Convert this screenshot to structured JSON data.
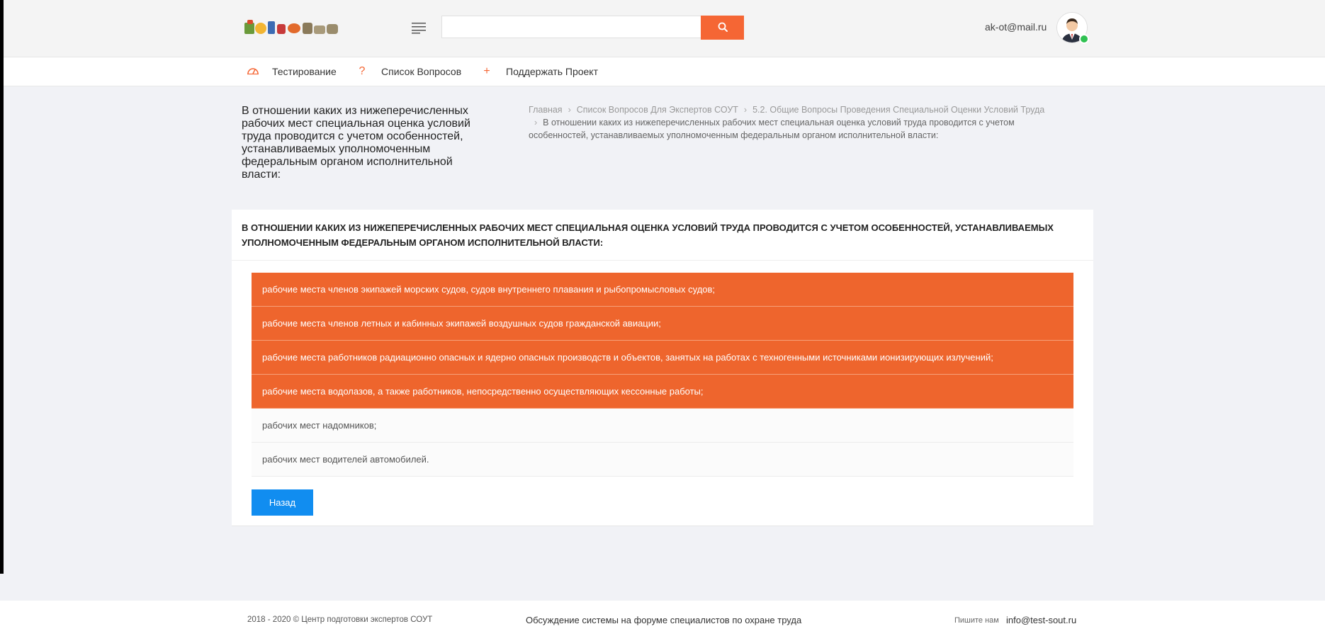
{
  "header": {
    "logo_icon": "brand-logo",
    "search": {
      "value": "",
      "placeholder": ""
    },
    "user_email": "ak-ot@mail.ru"
  },
  "nav": {
    "items": [
      {
        "label": "Тестирование",
        "icon": "gauge-icon"
      },
      {
        "label": "Список Вопросов",
        "icon": "question-icon"
      },
      {
        "label": "Поддержать Проект",
        "icon": "plus-icon"
      }
    ]
  },
  "page": {
    "title": "В отношении каких из нижеперечисленных рабочих мест специальная оценка условий труда проводится с учетом особенностей, устанавливаемых уполномоченным федеральным органом исполнительной власти:",
    "breadcrumb": {
      "home": "Главная",
      "list": "Список Вопросов Для Экспертов СОУТ",
      "section": "5.2. Общие Вопросы Проведения Специальной Оценки Условий Труда",
      "current": "В отношении каких из нижеперечисленных рабочих мест специальная оценка условий труда проводится с учетом особенностей, устанавливаемых уполномоченным федеральным органом исполнительной власти:"
    }
  },
  "question": {
    "heading": "В ОТНОШЕНИИ КАКИХ ИЗ НИЖЕПЕРЕЧИСЛЕННЫХ РАБОЧИХ МЕСТ СПЕЦИАЛЬНАЯ ОЦЕНКА УСЛОВИЙ ТРУДА ПРОВОДИТСЯ С УЧЕТОМ ОСОБЕННОСТЕЙ, УСТАНАВЛИВАЕМЫХ УПОЛНОМОЧЕННЫМ ФЕДЕРАЛЬНЫМ ОРГАНОМ ИСПОЛНИТЕЛЬНОЙ ВЛАСТИ:",
    "answers": [
      {
        "text": "рабочие места членов экипажей морских судов, судов внутреннего плавания и рыбопромысловых судов;"
      },
      {
        "text": "рабочие места членов летных и кабинных экипажей воздушных судов гражданской авиации;"
      },
      {
        "text": "рабочие места работников радиационно опасных и ядерно опасных производств и объектов, занятых на работах с техногенными источниками ионизирующих излучений;"
      },
      {
        "text": "рабочие места водолазов, а также работников, непосредственно осуществляющих кессонные работы;"
      },
      {
        "text": "рабочих мест надомников;"
      },
      {
        "text": "рабочих мест водителей автомобилей."
      }
    ],
    "back_label": "Назад"
  },
  "footer": {
    "copyright": "2018 - 2020 © Центр подготовки экспертов СОУТ",
    "forum_link": "Обсуждение системы на форуме специалистов по охране труда",
    "write_label": "Пишите нам",
    "email": "info@test-sout.ru"
  },
  "colors": {
    "accent": "#ee652d",
    "search_button": "#f56634",
    "back_button": "#118df0",
    "online": "#30c152"
  }
}
